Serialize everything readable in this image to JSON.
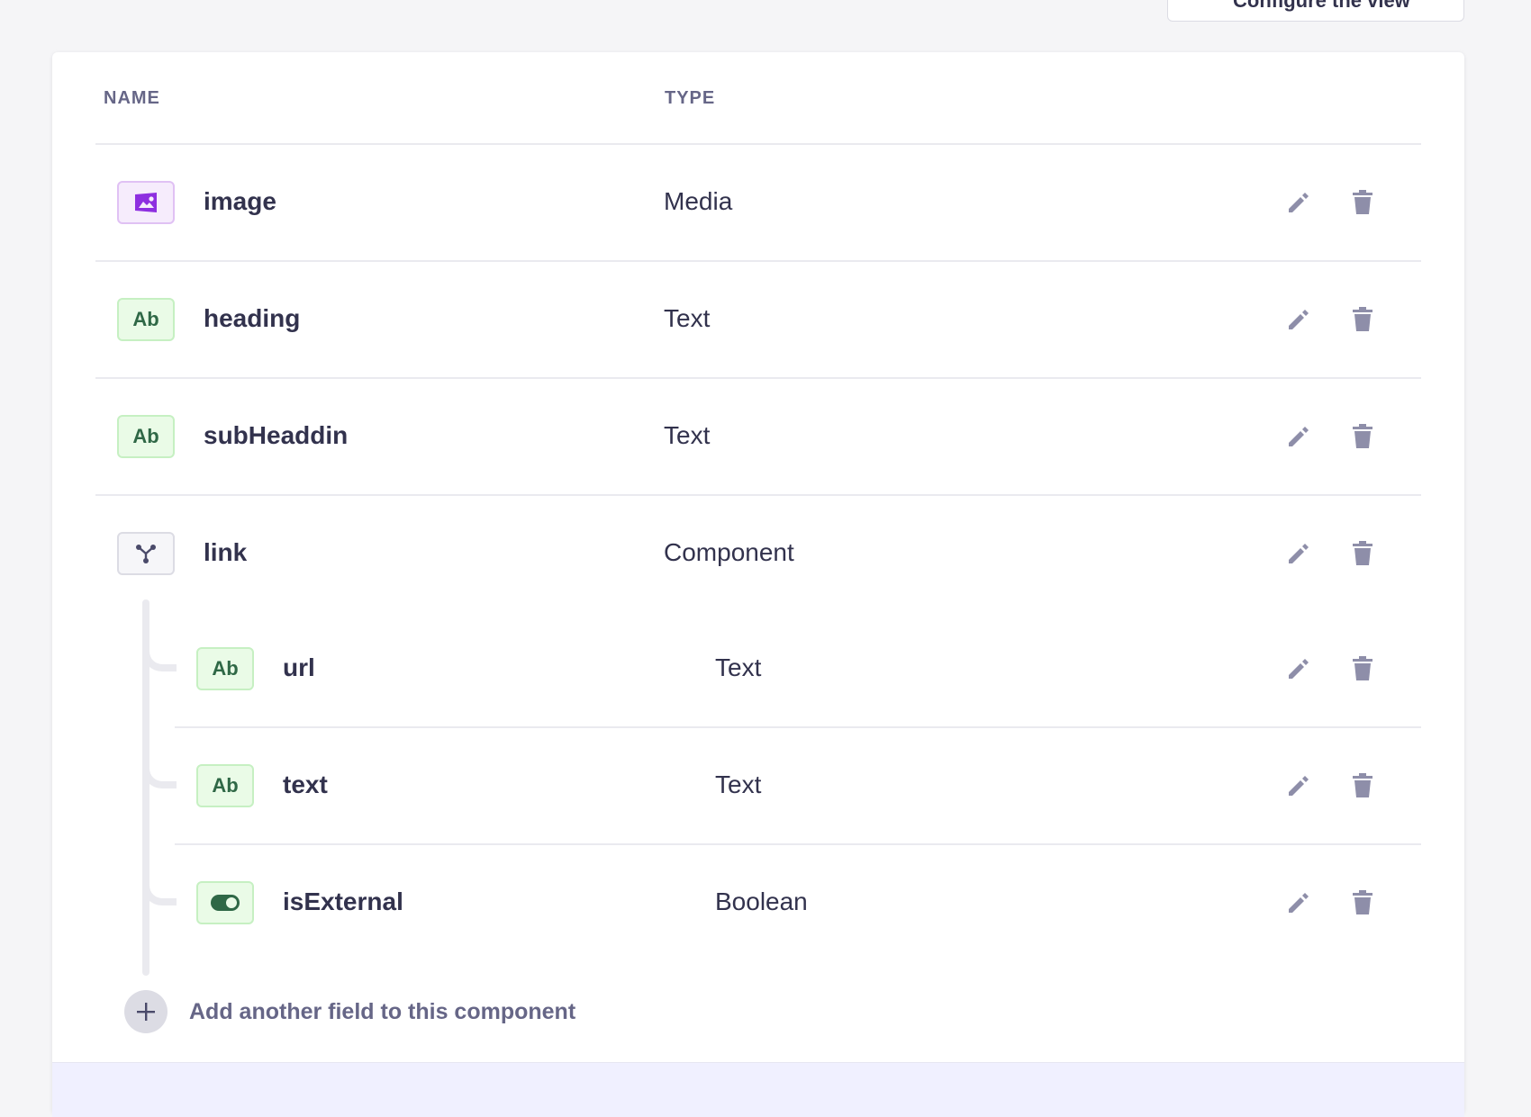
{
  "toolbar": {
    "configure_label": "Configure the view"
  },
  "table": {
    "headers": {
      "name": "NAME",
      "type": "TYPE"
    },
    "rows": [
      {
        "name": "image",
        "type": "Media",
        "icon": "media-icon"
      },
      {
        "name": "heading",
        "type": "Text",
        "icon": "text-icon",
        "icon_text": "Ab"
      },
      {
        "name": "subHeaddin",
        "type": "Text",
        "icon": "text-icon",
        "icon_text": "Ab"
      },
      {
        "name": "link",
        "type": "Component",
        "icon": "component-icon"
      }
    ],
    "sub_rows": [
      {
        "name": "url",
        "type": "Text",
        "icon": "text-icon",
        "icon_text": "Ab"
      },
      {
        "name": "text",
        "type": "Text",
        "icon": "text-icon",
        "icon_text": "Ab"
      },
      {
        "name": "isExternal",
        "type": "Boolean",
        "icon": "boolean-icon"
      }
    ],
    "add_field_label": "Add another field to this component"
  },
  "colors": {
    "media_accent": "#8e2fe0",
    "text_accent": "#2f6846",
    "action_icon": "#8e8ea9"
  }
}
